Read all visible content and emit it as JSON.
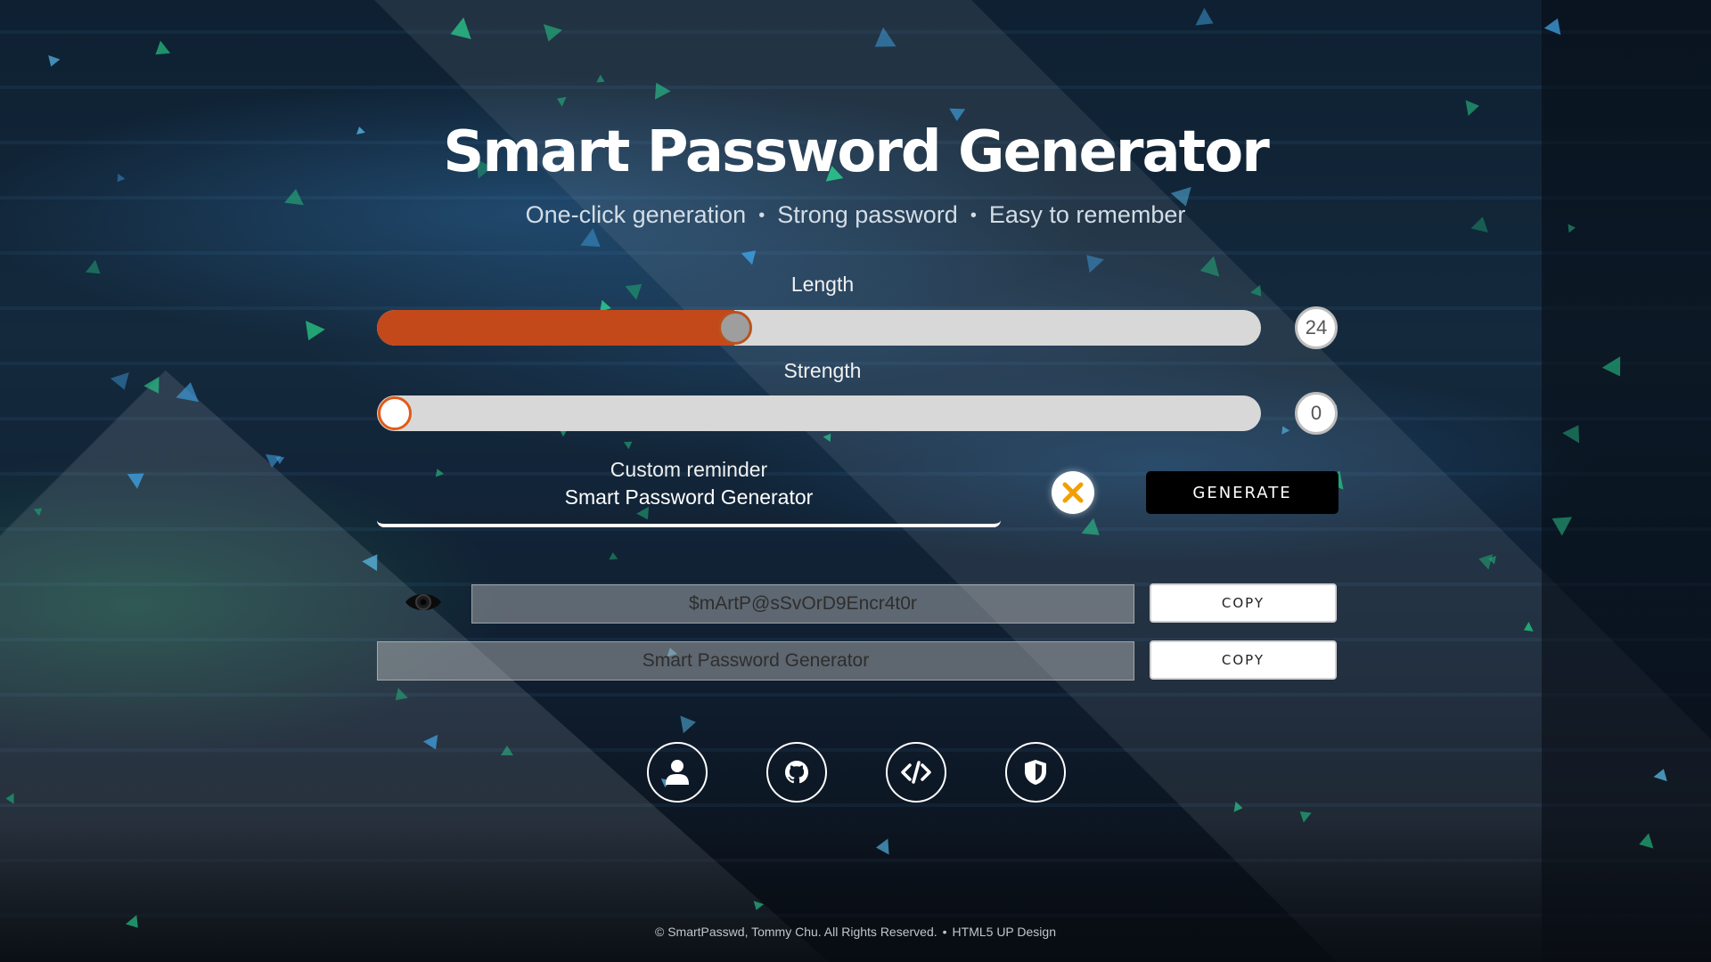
{
  "header": {
    "title": "Smart Password Generator",
    "taglines": [
      "One-click generation",
      "Strong password",
      "Easy to remember"
    ],
    "separator": "•"
  },
  "length": {
    "label": "Length",
    "value": "24",
    "fill_fraction": 0.4
  },
  "strength": {
    "label": "Strength",
    "value": "0",
    "fill_fraction": 0.0
  },
  "reminder": {
    "label": "Custom reminder",
    "value": "Smart Password Generator"
  },
  "actions": {
    "generate_label": "GENERATE",
    "clear_icon": "close-icon"
  },
  "output": {
    "password": "$mArtP@sSvOrD9Encr4t0r",
    "reminder_text": "Smart Password Generator",
    "copy_label": "COPY",
    "visibility_icon": "eye-icon"
  },
  "links": [
    {
      "icon": "user-icon"
    },
    {
      "icon": "github-icon"
    },
    {
      "icon": "code-icon"
    },
    {
      "icon": "shield-icon"
    }
  ],
  "footer": {
    "copyright": "© SmartPasswd, Tommy Chu. All Rights Reserved.",
    "separator": "•",
    "design": "HTML5 UP Design"
  },
  "colors": {
    "slider_fill": "#c3481a",
    "slider_track": "#d8d8d8",
    "clear_accent": "#f0a000",
    "button_dark": "#000000"
  }
}
